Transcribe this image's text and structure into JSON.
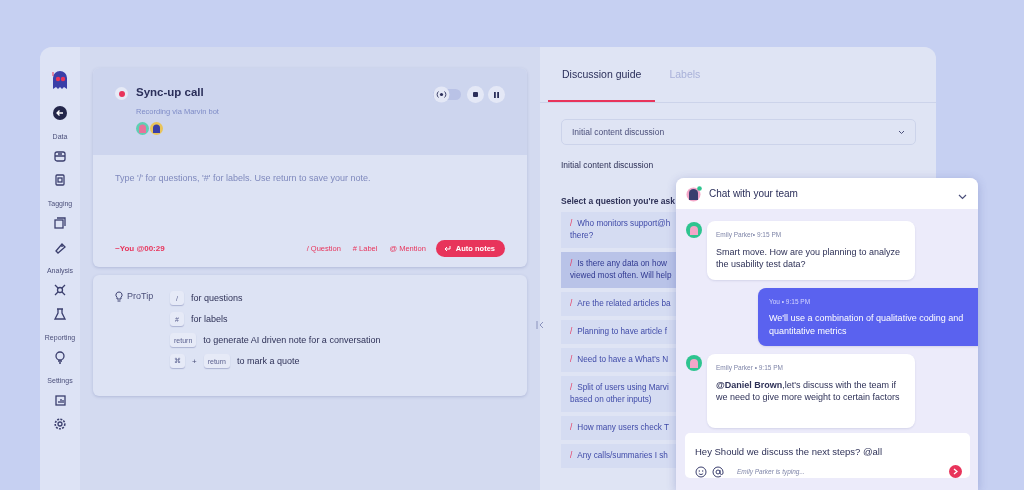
{
  "sidebar": {
    "sections": [
      {
        "label": "Data"
      },
      {
        "label": "Tagging"
      },
      {
        "label": "Analysis"
      },
      {
        "label": "Reporting"
      },
      {
        "label": "Settings"
      }
    ]
  },
  "recording_card": {
    "title": "Sync-up call",
    "recording": true,
    "broadcast_on": false,
    "subtitle": "Recording via Marvin bot",
    "note_placeholder": "Type '/' for questions, '#' for labels. Use return to save your note.",
    "author_time": "~You @00:29",
    "shortcuts": [
      "/ Question",
      "# Label",
      "@ Mention"
    ],
    "auto_notes": "Auto notes"
  },
  "protip": {
    "label": "ProTip",
    "rows": [
      {
        "keys": [
          "/"
        ],
        "text": "for questions"
      },
      {
        "keys": [
          "#"
        ],
        "text": "for labels"
      },
      {
        "keys": [
          "return"
        ],
        "text": "to generate AI driven note for a conversation"
      },
      {
        "keys": [
          "⌘",
          "return"
        ],
        "joiner": "+",
        "text": "to mark a quote"
      }
    ]
  },
  "tabs": [
    {
      "label": "Discussion guide",
      "selected": true
    },
    {
      "label": "Labels",
      "selected": false
    }
  ],
  "dropdown": {
    "value": "Initial content discussion"
  },
  "section_title": "Initial content discussion",
  "question_prompt": "Select a question you're ask",
  "questions": [
    {
      "marker": "/",
      "lines": [
        "Who monitors support@h",
        "there?"
      ],
      "highlighted": false
    },
    {
      "marker": "/",
      "lines": [
        "Is there any data on how",
        "viewed most often. Will help"
      ],
      "highlighted": true
    },
    {
      "marker": "/",
      "lines": [
        "Are the related articles ba"
      ],
      "highlighted": false
    },
    {
      "marker": "/",
      "lines": [
        "Planning to have article f"
      ],
      "highlighted": false
    },
    {
      "marker": "/",
      "lines": [
        "Need to have a What's N"
      ],
      "highlighted": false
    },
    {
      "marker": "/",
      "lines": [
        "Split of users using Marvi",
        "based on other inputs)"
      ],
      "highlighted": false
    },
    {
      "marker": "/",
      "lines": [
        "How many users check T"
      ],
      "highlighted": false
    },
    {
      "marker": "/",
      "lines": [
        "Any calls/summaries I sh"
      ],
      "highlighted": false
    }
  ],
  "chat": {
    "title": "Chat with your team",
    "online": true,
    "messages": [
      {
        "kind": "incoming",
        "meta": "Emily Parker• 9:15 PM",
        "text": "Smart move. How are you planning to analyze the usability test data?"
      },
      {
        "kind": "outgoing",
        "meta": "You • 9:15 PM",
        "text": "We'll use a combination of qualitative coding and quantitative metrics"
      },
      {
        "kind": "incoming",
        "meta": "Emily Parker • 9:15 PM",
        "text": "**@Daniel Brown**,let's discuss with the team if we need to give more weight to certain factors"
      }
    ],
    "input": {
      "value": "Hey Should we discuss the next steps? @all",
      "typing": "Emily Parker is typing..."
    }
  }
}
